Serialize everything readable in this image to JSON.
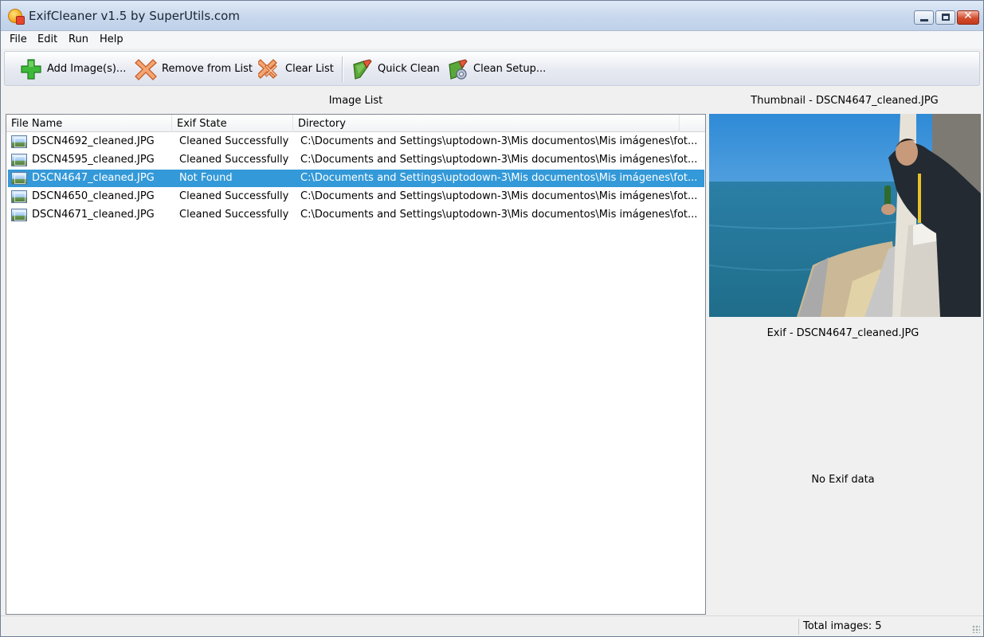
{
  "window": {
    "title": "ExifCleaner v1.5 by SuperUtils.com",
    "close_glyph": "✕"
  },
  "menu": {
    "items": [
      "File",
      "Edit",
      "Run",
      "Help"
    ]
  },
  "toolbar": {
    "add_label": "Add Image(s)...",
    "remove_label": "Remove from List",
    "clear_label": "Clear List",
    "quick_clean_label": "Quick Clean",
    "clean_setup_label": "Clean Setup..."
  },
  "image_list": {
    "header": "Image List",
    "columns": [
      "File Name",
      "Exif State",
      "Directory"
    ],
    "rows": [
      {
        "file": "DSCN4692_cleaned.JPG",
        "state": "Cleaned Successfully",
        "dir": "C:\\Documents and Settings\\uptodown-3\\Mis documentos\\Mis imágenes\\fot..."
      },
      {
        "file": "DSCN4595_cleaned.JPG",
        "state": "Cleaned Successfully",
        "dir": "C:\\Documents and Settings\\uptodown-3\\Mis documentos\\Mis imágenes\\fot..."
      },
      {
        "file": "DSCN4647_cleaned.JPG",
        "state": "Not Found",
        "dir": "C:\\Documents and Settings\\uptodown-3\\Mis documentos\\Mis imágenes\\fot..."
      },
      {
        "file": "DSCN4650_cleaned.JPG",
        "state": "Cleaned Successfully",
        "dir": "C:\\Documents and Settings\\uptodown-3\\Mis documentos\\Mis imágenes\\fot..."
      },
      {
        "file": "DSCN4671_cleaned.JPG",
        "state": "Cleaned Successfully",
        "dir": "C:\\Documents and Settings\\uptodown-3\\Mis documentos\\Mis imágenes\\fot..."
      }
    ],
    "selected_index": 2
  },
  "thumbnail": {
    "header": "Thumbnail - DSCN4647_cleaned.JPG"
  },
  "exif": {
    "header": "Exif - DSCN4647_cleaned.JPG",
    "message": "No Exif data"
  },
  "status": {
    "total_images": "Total images: 5"
  },
  "colors": {
    "selection": "#3399d8",
    "title_gradient_top": "#dfe9f6"
  },
  "icons": [
    "app-icon",
    "add-icon",
    "remove-icon",
    "clear-icon",
    "quick-clean-icon",
    "clean-setup-icon",
    "image-file-icon"
  ]
}
